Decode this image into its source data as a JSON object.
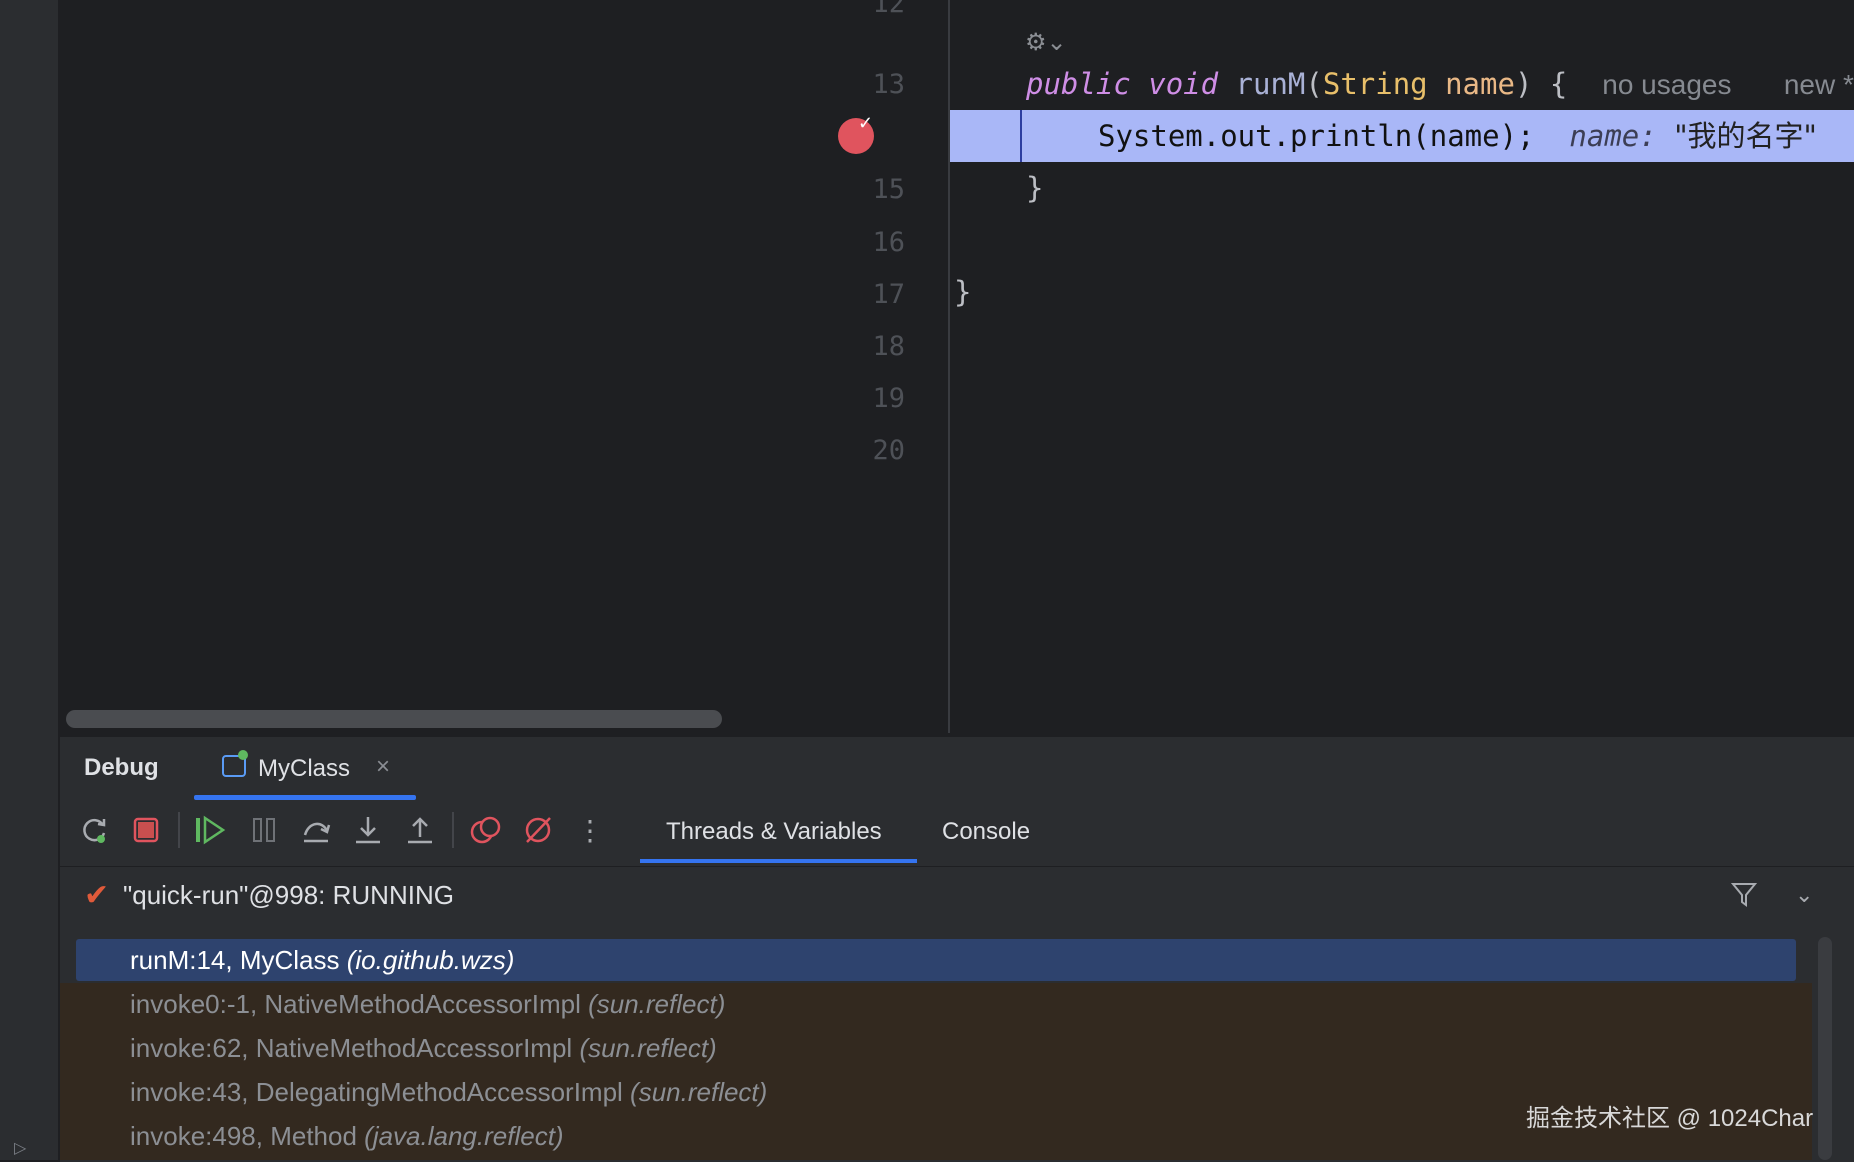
{
  "editor": {
    "line_numbers": [
      "12",
      "13",
      "15",
      "16",
      "17",
      "18",
      "19",
      "20"
    ],
    "gear_icon": "chevron-gear-icon",
    "code": {
      "line13": {
        "public": "public",
        "void": "void",
        "method": "runM",
        "open_paren": "(",
        "type": "String",
        "param": "name",
        "close": ") {",
        "hint_usages": "no usages",
        "hint_new": "new *"
      },
      "line14": {
        "text": "System.out.println(name);",
        "hint_name": "name:",
        "hint_value": "\"我的名字\""
      },
      "line15": "}",
      "line17": "}"
    }
  },
  "debug": {
    "title": "Debug",
    "tab": {
      "label": "MyClass",
      "close": "×"
    },
    "toolbar": {
      "rerun": "rerun-icon",
      "stop": "stop-icon",
      "resume": "resume-icon",
      "pause": "pause-icon",
      "step_over": "step-over-icon",
      "step_into": "step-into-icon",
      "step_out": "step-out-icon",
      "view_breakpoints": "view-breakpoints-icon",
      "mute_breakpoints": "mute-breakpoints-icon",
      "more": "more-icon"
    },
    "subtabs": {
      "threads": "Threads & Variables",
      "console": "Console"
    },
    "thread": {
      "label": "\"quick-run\"@998: RUNNING"
    },
    "frames": [
      {
        "method": "runM:14, MyClass ",
        "pkg": "(io.github.wzs)"
      },
      {
        "method": "invoke0:-1, NativeMethodAccessorImpl ",
        "pkg": "(sun.reflect)"
      },
      {
        "method": "invoke:62, NativeMethodAccessorImpl ",
        "pkg": "(sun.reflect)"
      },
      {
        "method": "invoke:43, DelegatingMethodAccessorImpl ",
        "pkg": "(sun.reflect)"
      },
      {
        "method": "invoke:498, Method ",
        "pkg": "(java.lang.reflect)"
      }
    ]
  },
  "watermark": "掘金技术社区 @ 1024Char",
  "colors": {
    "accent": "#3574f0",
    "breakpoint": "#e0545e",
    "current_line": "#a9b7f7"
  }
}
